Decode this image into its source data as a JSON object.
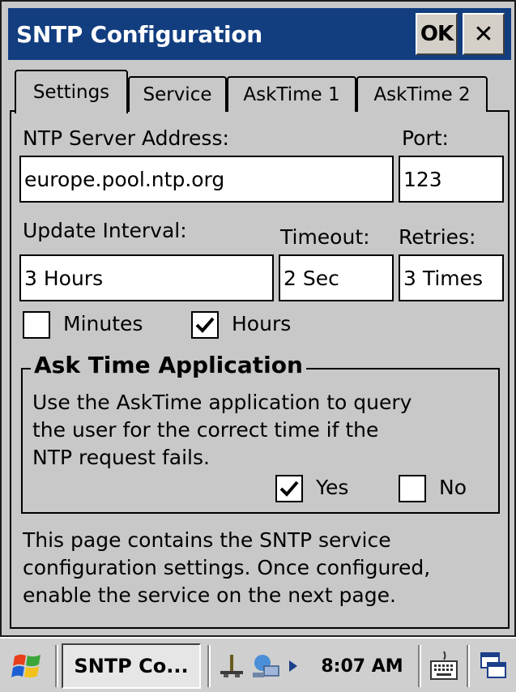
{
  "window": {
    "title": "SNTP Configuration",
    "ok_label": "OK",
    "close_label": "✕"
  },
  "tabs": [
    {
      "label": "Settings",
      "active": true
    },
    {
      "label": "Service",
      "active": false
    },
    {
      "label": "AskTime 1",
      "active": false
    },
    {
      "label": "AskTime 2",
      "active": false
    }
  ],
  "settings": {
    "server_label": "NTP Server Address:",
    "server_value": "europe.pool.ntp.org",
    "port_label": "Port:",
    "port_value": "123",
    "interval_label": "Update Interval:",
    "interval_value": "3 Hours",
    "timeout_label": "Timeout:",
    "timeout_value": "2 Sec",
    "retries_label": "Retries:",
    "retries_value": "3 Times",
    "minutes_label": "Minutes",
    "minutes_checked": false,
    "hours_label": "Hours",
    "hours_checked": true
  },
  "asktime": {
    "group_title": "Ask Time Application",
    "description_lines": [
      "Use the AskTime application to query",
      "the user for the correct time if the",
      "NTP request fails."
    ],
    "yes_label": "Yes",
    "yes_checked": true,
    "no_label": "No",
    "no_checked": false
  },
  "footer_lines": [
    "This page contains the SNTP service",
    "configuration settings. Once configured,",
    "enable the service on the next page."
  ],
  "taskbar": {
    "task_label": "SNTP Co...",
    "clock": "8:07 AM"
  },
  "colors": {
    "titlebar": "#123e80",
    "window_bg": "#c8c8c8"
  }
}
